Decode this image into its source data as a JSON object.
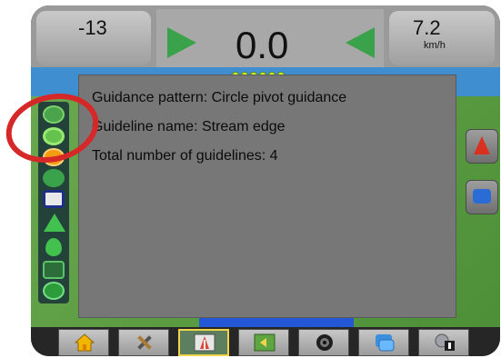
{
  "top_bar": {
    "cross_track_error": "-13",
    "heading": "0.0",
    "speed": "7.2",
    "speed_unit": "km/h"
  },
  "info_panel": {
    "lines": [
      "Guidance pattern: Circle pivot guidance",
      "Guideline name: Stream edge",
      "Total number of guidelines: 4"
    ]
  },
  "left_toolbar": {
    "icons": [
      "mark-a-icon",
      "circle-pivot-icon",
      "lock-icon",
      "pivot-green-icon",
      "gps-icon",
      "triangle-up-icon",
      "droplet-icon",
      "sprayer-icon",
      "link-icon"
    ]
  },
  "right_toolbar": {
    "icons": [
      "north-arrow-icon",
      "comment-icon"
    ]
  },
  "bottom_tabs": {
    "items": [
      {
        "name": "home-tab",
        "icon": "home-icon"
      },
      {
        "name": "tools-tab",
        "icon": "tools-icon"
      },
      {
        "name": "guidance-tab",
        "icon": "guidance-icon",
        "active": true
      },
      {
        "name": "map-tab",
        "icon": "map-icon"
      },
      {
        "name": "camera-tab",
        "icon": "camera-icon"
      },
      {
        "name": "data-tab",
        "icon": "data-icon"
      },
      {
        "name": "info-tab",
        "icon": "info-icon"
      }
    ]
  },
  "colors": {
    "steering_arrow": "#3aa24a",
    "annotation_circle": "#d62828",
    "overlay": "#777777",
    "active_tab_border": "#f0d44a"
  }
}
